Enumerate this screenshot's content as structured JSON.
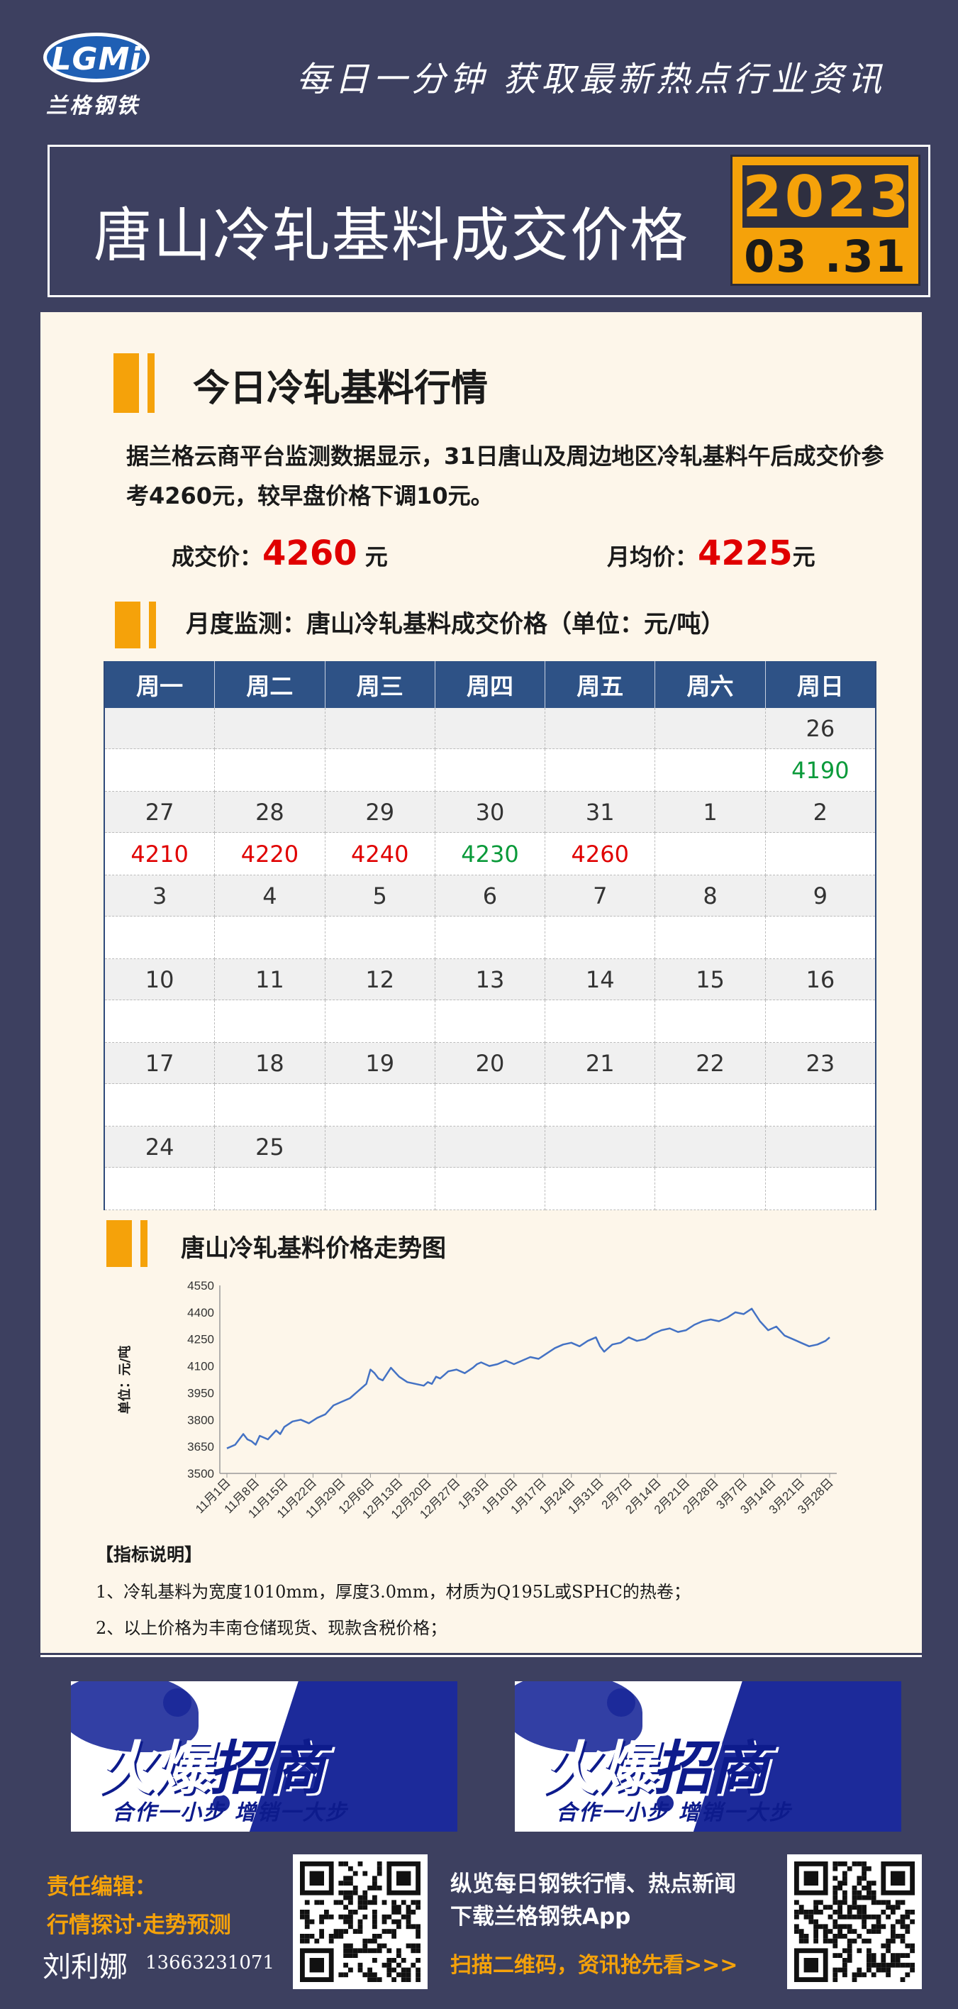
{
  "header": {
    "logo_text": "LGMi",
    "logo_cn": "兰格钢铁",
    "slogan": "每日一分钟  获取最新热点行业资讯",
    "title": "唐山冷轧基料成交价格",
    "year": "2023",
    "date": "03 .31"
  },
  "summary": {
    "heading": "今日冷轧基料行情",
    "paragraph": "据兰格云商平台监测数据显示，31日唐山及周边地区冷轧基料午后成交价参考4260元，较早盘价格下调10元。",
    "deal_label": "成交价：",
    "deal_value": "4260",
    "deal_unit": " 元",
    "avg_label": "月均价：",
    "avg_value": "4225",
    "avg_unit": "元"
  },
  "calendar": {
    "heading": "月度监测：唐山冷轧基料成交价格（单位：元/吨）",
    "weekdays": [
      "周一",
      "周二",
      "周三",
      "周四",
      "周五",
      "周六",
      "周日"
    ],
    "weeks": [
      {
        "dates": [
          "",
          "",
          "",
          "",
          "",
          "",
          "26"
        ],
        "values": [
          "",
          "",
          "",
          "",
          "",
          "",
          "4190"
        ],
        "trend": [
          "",
          "",
          "",
          "",
          "",
          "",
          "down"
        ]
      },
      {
        "dates": [
          "27",
          "28",
          "29",
          "30",
          "31",
          "1",
          "2"
        ],
        "values": [
          "4210",
          "4220",
          "4240",
          "4230",
          "4260",
          "",
          ""
        ],
        "trend": [
          "up",
          "up",
          "up",
          "down",
          "up",
          "",
          ""
        ]
      },
      {
        "dates": [
          "3",
          "4",
          "5",
          "6",
          "7",
          "8",
          "9"
        ],
        "values": [
          "",
          "",
          "",
          "",
          "",
          "",
          ""
        ],
        "trend": [
          "",
          "",
          "",
          "",
          "",
          "",
          ""
        ]
      },
      {
        "dates": [
          "10",
          "11",
          "12",
          "13",
          "14",
          "15",
          "16"
        ],
        "values": [
          "",
          "",
          "",
          "",
          "",
          "",
          ""
        ],
        "trend": [
          "",
          "",
          "",
          "",
          "",
          "",
          ""
        ]
      },
      {
        "dates": [
          "17",
          "18",
          "19",
          "20",
          "21",
          "22",
          "23"
        ],
        "values": [
          "",
          "",
          "",
          "",
          "",
          "",
          ""
        ],
        "trend": [
          "",
          "",
          "",
          "",
          "",
          "",
          ""
        ]
      },
      {
        "dates": [
          "24",
          "25",
          "",
          "",
          "",
          "",
          ""
        ],
        "values": [
          "",
          "",
          "",
          "",
          "",
          "",
          ""
        ],
        "trend": [
          "",
          "",
          "",
          "",
          "",
          "",
          ""
        ]
      }
    ],
    "colors": {
      "up": "#e00000",
      "down": "#0a9a3a",
      "header": "#2e5286"
    }
  },
  "chart_heading": "唐山冷轧基料价格走势图",
  "chart_data": {
    "type": "line",
    "title": "",
    "ylabel": "单位：元/吨",
    "xlabel": "",
    "ylim": [
      3500,
      4550
    ],
    "yticks": [
      3500,
      3650,
      3800,
      3950,
      4100,
      4250,
      4400,
      4550
    ],
    "xtick_labels": [
      "11月1日",
      "11月8日",
      "11月15日",
      "11月22日",
      "11月29日",
      "12月6日",
      "12月13日",
      "12月20日",
      "12月27日",
      "1月3日",
      "1月10日",
      "1月17日",
      "1月24日",
      "1月31日",
      "2月7日",
      "2月14日",
      "2月21日",
      "2月28日",
      "3月7日",
      "3月14日",
      "3月21日",
      "3月28日"
    ],
    "series": [
      {
        "color": "#4472c4",
        "x": [
          0,
          2,
          4,
          5,
          6,
          7,
          8,
          10,
          12,
          13,
          14,
          16,
          18,
          20,
          22,
          24,
          26,
          28,
          30,
          32,
          34,
          35,
          36,
          37,
          38,
          40,
          42,
          44,
          46,
          48,
          49,
          50,
          51,
          52,
          53,
          54,
          56,
          58,
          60,
          61,
          62,
          64,
          66,
          68,
          70,
          72,
          74,
          76,
          78,
          80,
          82,
          84,
          86,
          88,
          89,
          90,
          91,
          92,
          94,
          96,
          98,
          100,
          102,
          104,
          106,
          108,
          110,
          112,
          114,
          116,
          118,
          120,
          122,
          124,
          126,
          128,
          130,
          132,
          134,
          136,
          137,
          138,
          139,
          140,
          142,
          144,
          146,
          147
        ],
        "values": [
          3640,
          3660,
          3720,
          3690,
          3680,
          3660,
          3710,
          3690,
          3740,
          3720,
          3760,
          3790,
          3800,
          3780,
          3810,
          3830,
          3880,
          3900,
          3920,
          3960,
          4000,
          4080,
          4060,
          4030,
          4020,
          4090,
          4040,
          4010,
          4000,
          3990,
          4010,
          4000,
          4040,
          4030,
          4050,
          4070,
          4080,
          4060,
          4090,
          4110,
          4120,
          4100,
          4110,
          4130,
          4110,
          4130,
          4150,
          4140,
          4170,
          4200,
          4220,
          4230,
          4210,
          4240,
          4250,
          4260,
          4210,
          4180,
          4220,
          4230,
          4260,
          4240,
          4250,
          4280,
          4300,
          4310,
          4290,
          4300,
          4330,
          4350,
          4360,
          4350,
          4370,
          4400,
          4390,
          4420,
          4350,
          4300,
          4320,
          4270,
          4260,
          4250,
          4240,
          4230,
          4210,
          4220,
          4240,
          4260
        ]
      }
    ]
  },
  "notes": {
    "title": "【指标说明】",
    "items": [
      "1、冷轧基料为宽度1010mm，厚度3.0mm，材质为Q195L或SPHC的热卷；",
      "2、以上价格为丰南仓储现货、现款含税价格；"
    ]
  },
  "banners": {
    "title_a": "火爆",
    "title_b": "招商",
    "subtitle": "合作一小步  增销一大步"
  },
  "footer": {
    "editor_label": "责任编辑：",
    "topic_label": "行情探讨·走势预测",
    "name": "刘利娜",
    "phone": "13663231071",
    "line1": "纵览每日钢铁行情、热点新闻",
    "line2": "下载兰格钢铁App",
    "line3": "扫描二维码，资讯抢先看>>>"
  }
}
